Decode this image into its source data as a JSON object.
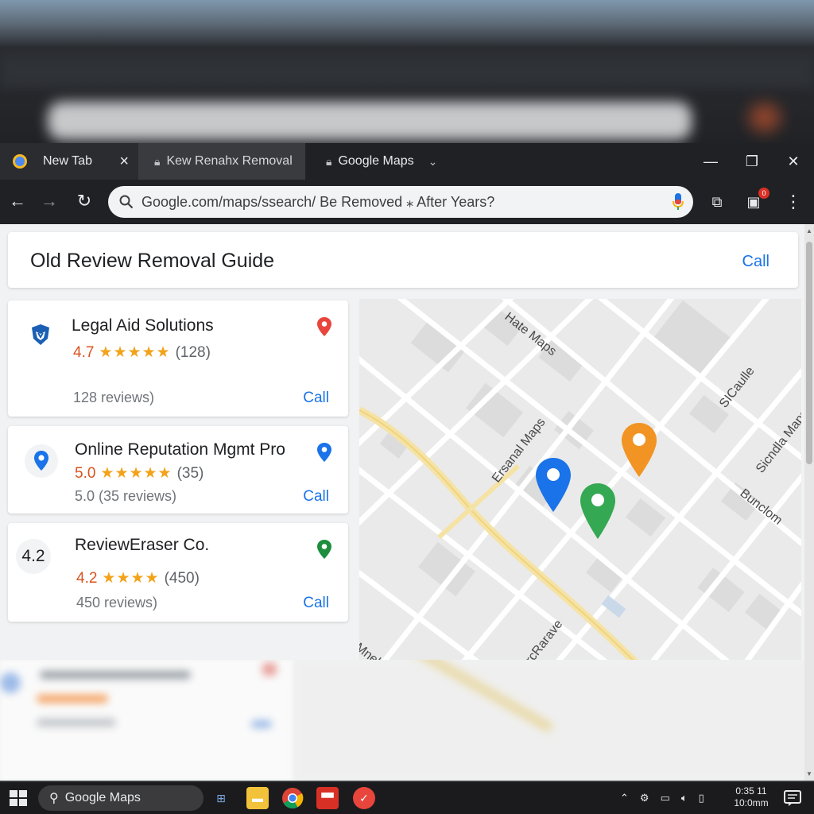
{
  "browser": {
    "tabs": [
      {
        "label": "New Tab",
        "close": "×"
      },
      {
        "label": "Kew Renahx Removal"
      },
      {
        "label": "Google Maps"
      }
    ],
    "address": "Google.com/maps/ssearch/ Be Removed ⁎ After Years?",
    "extension_badge": "0"
  },
  "header": {
    "title": "Old Review Removal Guide",
    "call_label": "Call"
  },
  "listings": [
    {
      "name": "Legal Aid Solutions",
      "rating": "4.7",
      "stars": "★★★★★",
      "count": "(128)",
      "reviews": "128 reviews)",
      "call": "Call",
      "pin_color": "#e8453c"
    },
    {
      "name": "Online Reputation Mgmt Pro",
      "rating": "5.0",
      "stars": "★★★★★",
      "count": "(35)",
      "reviews": "5.0 (35 reviews)",
      "call": "Call",
      "pin_color": "#1a73e8"
    },
    {
      "name": "ReviewEraser Co.",
      "avatar": "4.2",
      "rating": "4.2",
      "stars": "★★★★",
      "count": "(450)",
      "reviews": "450 reviews)",
      "call": "Call",
      "pin_color": "#1e8e3e"
    }
  ],
  "map": {
    "labels": [
      "Hate Maps",
      "SICaulle",
      "Ersanal Maps",
      "Sicndla Maps",
      "Bunclom",
      "rcRarave",
      "Mnel"
    ],
    "pins": [
      {
        "color": "#1a73e8"
      },
      {
        "color": "#f29423"
      },
      {
        "color": "#34a853"
      }
    ]
  },
  "taskbar": {
    "search_label": "Google Maps",
    "clock_time": "0:35 11",
    "clock_date": "10:0mm"
  }
}
